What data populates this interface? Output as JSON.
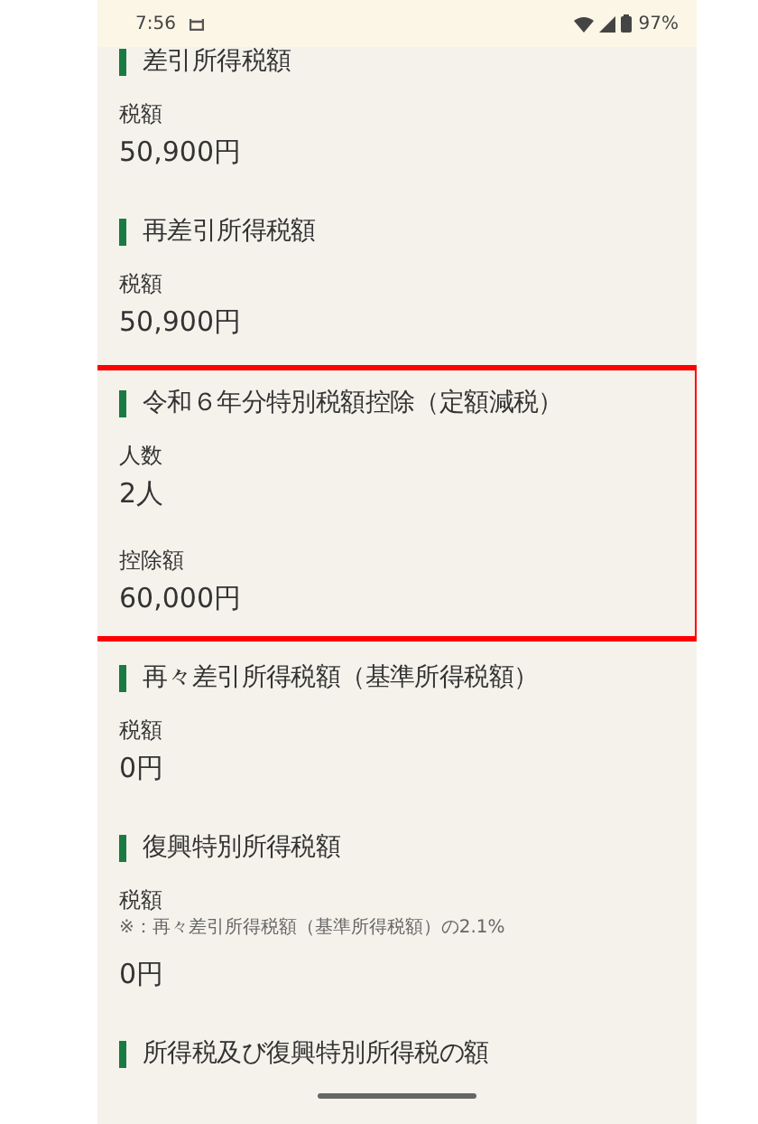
{
  "status_bar": {
    "time": "7:56",
    "battery": "97%"
  },
  "sections": [
    {
      "title": "差引所得税額",
      "highlighted": false,
      "fields": [
        {
          "label": "税額",
          "value": "50,900円"
        }
      ]
    },
    {
      "title": "再差引所得税額",
      "highlighted": false,
      "fields": [
        {
          "label": "税額",
          "value": "50,900円"
        }
      ]
    },
    {
      "title": "令和６年分特別税額控除（定額減税）",
      "highlighted": true,
      "fields": [
        {
          "label": "人数",
          "value": "2人"
        },
        {
          "label": "控除額",
          "value": "60,000円"
        }
      ]
    },
    {
      "title": "再々差引所得税額（基準所得税額）",
      "highlighted": false,
      "fields": [
        {
          "label": "税額",
          "value": "0円"
        }
      ]
    },
    {
      "title": "復興特別所得税額",
      "highlighted": false,
      "fields": [
        {
          "label": "税額",
          "note": "※：再々差引所得税額（基準所得税額）の2.1%",
          "value": "0円"
        }
      ]
    },
    {
      "title": "所得税及び復興特別所得税の額",
      "highlighted": false
    }
  ]
}
